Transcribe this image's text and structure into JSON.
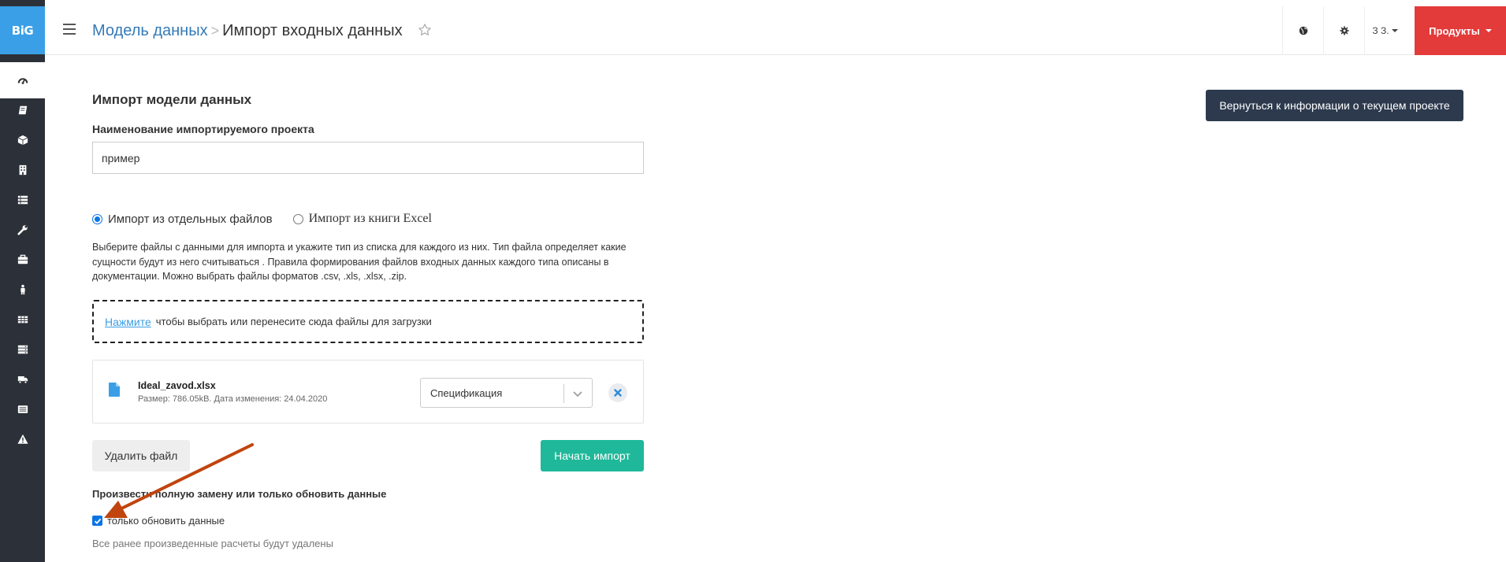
{
  "brand": {
    "logo_text": "BiG"
  },
  "sidebar": {
    "items": [
      {
        "icon": "dashboard-icon",
        "active": true
      },
      {
        "icon": "book-icon"
      },
      {
        "icon": "cube-icon"
      },
      {
        "icon": "building-icon"
      },
      {
        "icon": "list-icon"
      },
      {
        "icon": "wrench-icon"
      },
      {
        "icon": "briefcase-icon"
      },
      {
        "icon": "person-icon"
      },
      {
        "icon": "table-icon"
      },
      {
        "icon": "server-icon"
      },
      {
        "icon": "truck-icon"
      },
      {
        "icon": "card-list-icon"
      },
      {
        "icon": "warning-icon"
      }
    ]
  },
  "header": {
    "breadcrumb_parent": "Модель данных",
    "breadcrumb_separator": ">",
    "breadcrumb_current": "Импорт входных данных",
    "user_label": "З З.",
    "products_label": "Продукты"
  },
  "main": {
    "title": "Импорт модели данных",
    "back_button": "Вернуться к информации о текущем проекте",
    "project_name_label": "Наименование импортируемого проекта",
    "project_name_value": "пример",
    "radio_files": "Импорт из отдельных файлов",
    "radio_excel": "Импорт из книги Excel",
    "selected_mode": "files",
    "help_text": "Выберите файлы с данными для импорта и укажите тип из списка для каждого из них. Тип файла определяет какие сущности будут из него считываться . Правила формирования файлов входных данных каждого типа описаны в документации. Можно выбрать файлы форматов .csv, .xls, .xlsx, .zip.",
    "dropzone_link": "Нажмите",
    "dropzone_text": "чтобы выбрать или перенесите сюда файлы для загрузки",
    "file": {
      "name": "Ideal_zavod.xlsx",
      "meta": "Размер: 786.05kB. Дата изменения: 24.04.2020",
      "type": "Спецификация"
    },
    "delete_button": "Удалить файл",
    "start_button": "Начать импорт",
    "mode_label": "Произвести полную замену или только обновить данные",
    "update_only_label": "только обновить данные",
    "update_only_checked": true,
    "warning": "Все ранее произведенные расчеты будут удалены"
  },
  "colors": {
    "sidebar": "#2c3038",
    "brand": "#3a9fe6",
    "products": "#e33a3a",
    "back_button": "#2d3a4e",
    "start_button": "#1fb89a",
    "link": "#337ab7",
    "annotation_arrow": "#c1440e"
  }
}
